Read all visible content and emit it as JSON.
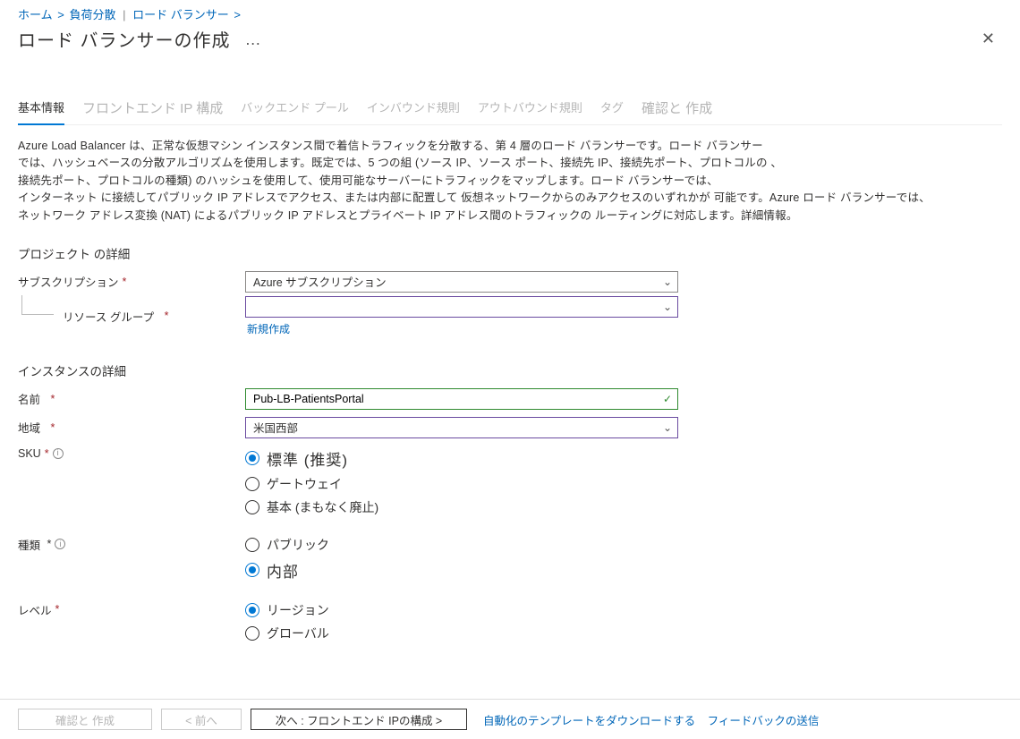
{
  "breadcrumbs": {
    "home": "ホーム",
    "lb_hub": "負荷分散",
    "lb": "ロード バランサー"
  },
  "page_title": "ロード バランサーの作成",
  "tabs": {
    "basic": "基本情報",
    "frontend": "フロントエンド IP 構成",
    "backend": "バックエンド プール",
    "inbound": "インバウンド規則",
    "outbound": "アウトバウンド規則",
    "tags": "タグ",
    "review": "確認と 作成"
  },
  "description": {
    "p1": "Azure Load Balancer は、正常な仮想マシン インスタンス間で着信トラフィックを分散する、第 4 層のロード バランサーです。ロード バランサー",
    "p2": "では、ハッシュベースの分散アルゴリズムを使用します。既定では、5 つの組 (ソース IP、ソース ポート、接続先 IP、接続先ポート、プロトコルの     、",
    "p3": " 接続先ポート、プロトコルの種類) のハッシュを使用して、使用可能なサーバーにトラフィックをマップします。ロード バランサーでは、",
    "p4": "インターネット に接続してパブリック IP アドレスでアクセス、または内部に配置して 仮想ネットワークからのみアクセスのいずれかが 可能です。Azure ロード バランサーでは、",
    "p5": "ネットワーク アドレス変換 (NAT) によるパブリック IP アドレスとプライベート IP アドレス間のトラフィックの ルーティングに対応します。詳細情報。"
  },
  "sections": {
    "project": "プロジェクト の詳細",
    "instance": "インスタンスの詳細"
  },
  "labels": {
    "subscription": "サブスクリプション",
    "resource_group": "リソース グループ",
    "name": "名前",
    "region": "地域",
    "sku": "SKU",
    "type": "種類",
    "tier": "レベル"
  },
  "values": {
    "subscription_selected": "Azure サブスクリプション",
    "resource_group_selected": "",
    "name_value": "Pub-LB-PatientsPortal",
    "region_selected": "米国西部"
  },
  "links": {
    "create_new": "新規作成"
  },
  "radios": {
    "sku": {
      "standard": "標準 (推奨)",
      "gateway": "ゲートウェイ",
      "basic": "基本 (まもなく廃止)",
      "selected": "standard"
    },
    "type": {
      "public": "パブリック",
      "internal": "内部",
      "selected": "internal"
    },
    "tier": {
      "region": "リージョン",
      "global": "グローバル",
      "selected": "region"
    }
  },
  "footer": {
    "review_create": "確認と 作成",
    "previous": "<  前へ",
    "next": "次へ :  フロントエンド IPの構成  >",
    "automation": "自動化のテンプレートをダウンロードする",
    "feedback": "フィードバックの送信"
  }
}
